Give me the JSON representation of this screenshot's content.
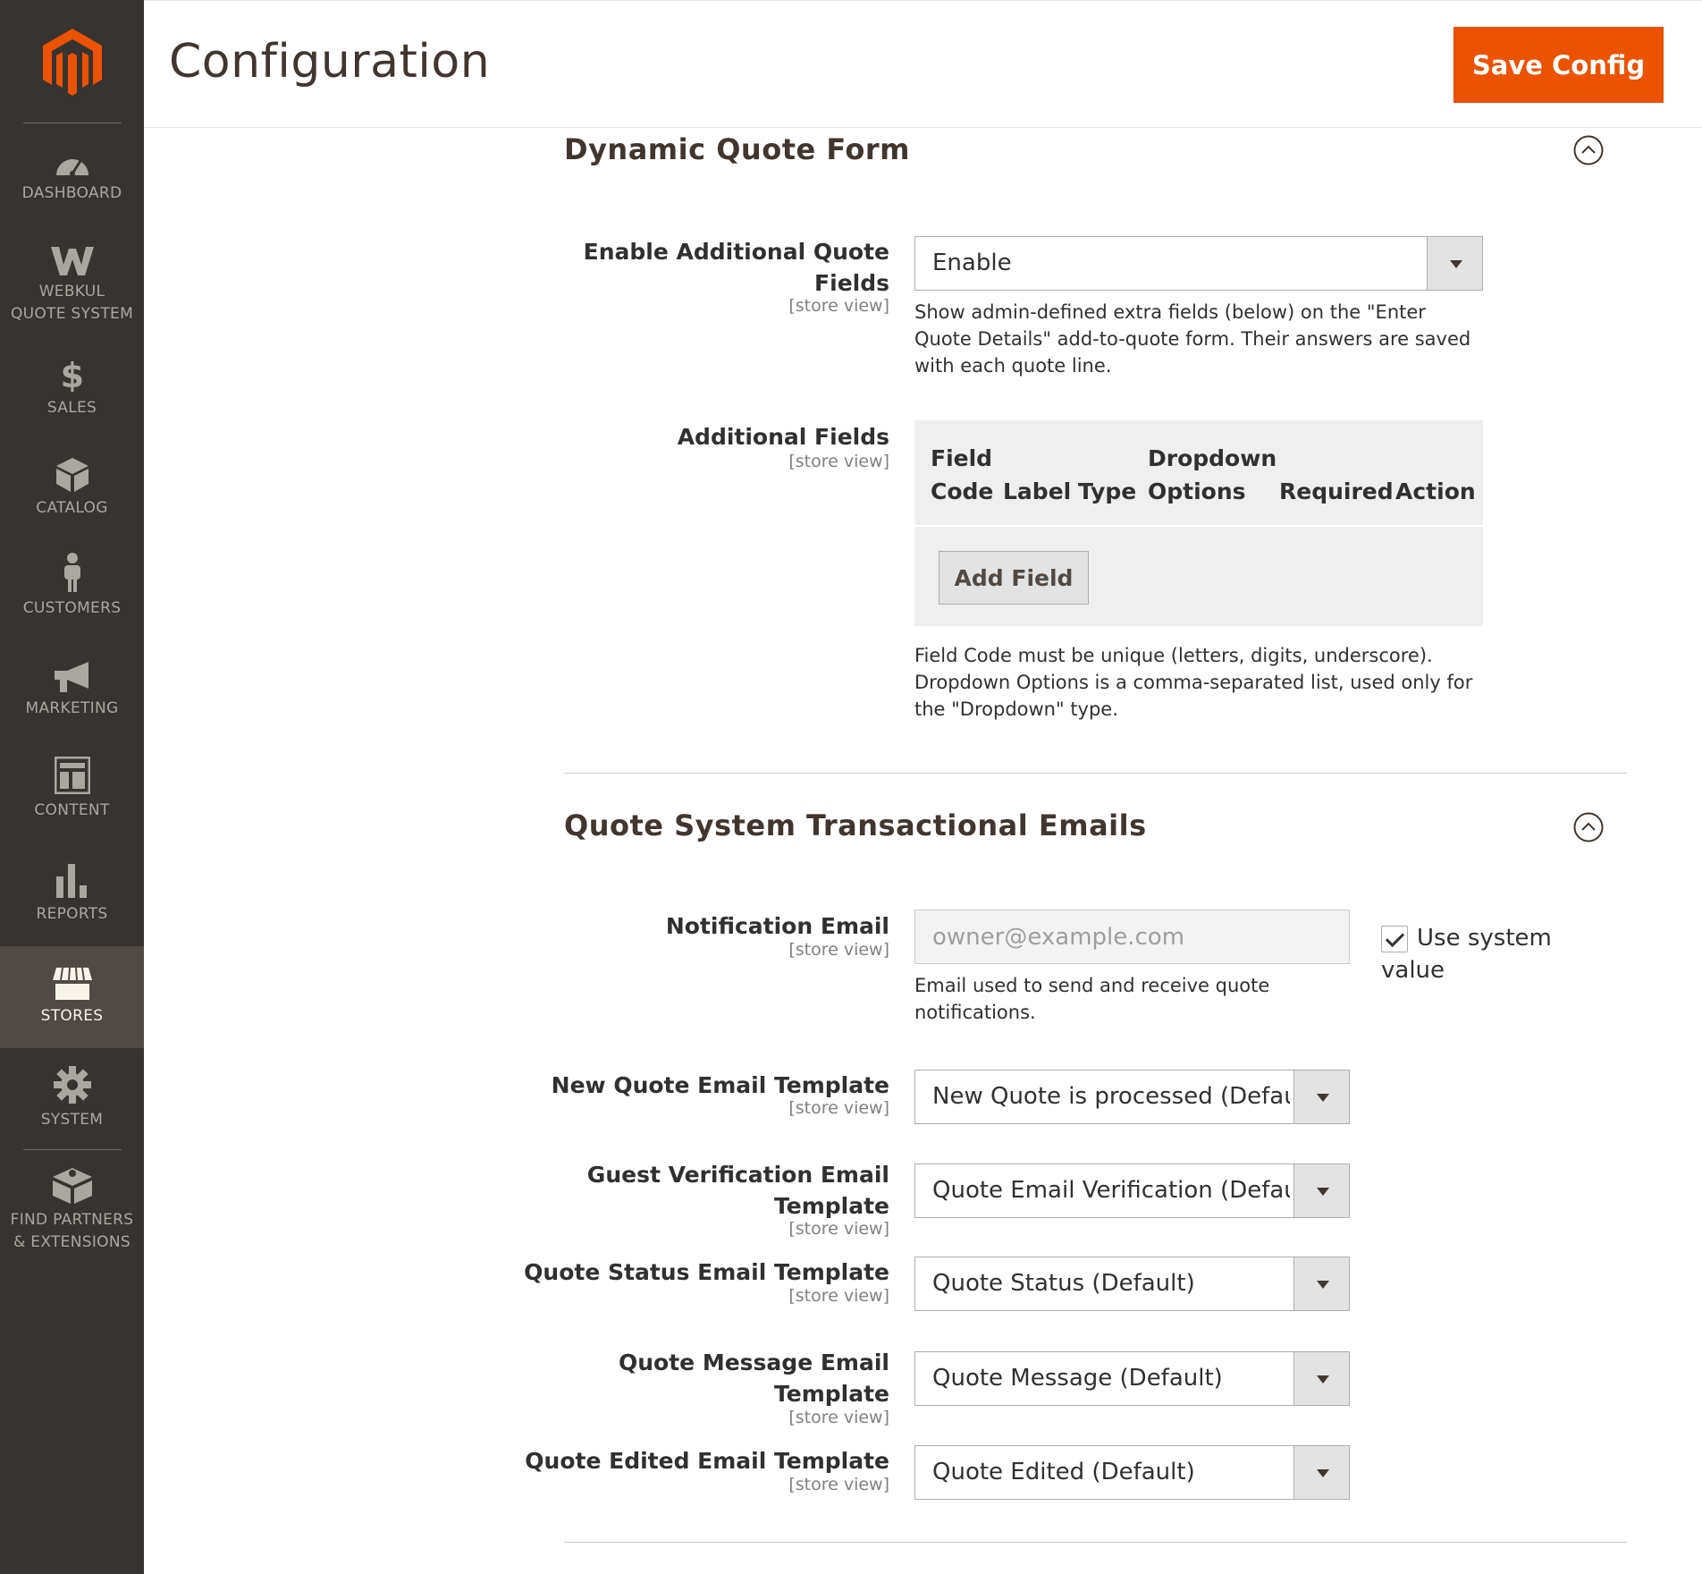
{
  "header": {
    "title": "Configuration",
    "save_label": "Save Config"
  },
  "sidebar": {
    "items": [
      {
        "label": "DASHBOARD",
        "icon": "dashboard-icon"
      },
      {
        "label": "WEBKUL QUOTE SYSTEM",
        "icon": "webkul-icon"
      },
      {
        "label": "SALES",
        "icon": "dollar-icon"
      },
      {
        "label": "CATALOG",
        "icon": "box-icon"
      },
      {
        "label": "CUSTOMERS",
        "icon": "person-icon"
      },
      {
        "label": "MARKETING",
        "icon": "megaphone-icon"
      },
      {
        "label": "CONTENT",
        "icon": "layout-icon"
      },
      {
        "label": "REPORTS",
        "icon": "bar-chart-icon"
      },
      {
        "label": "STORES",
        "icon": "store-icon",
        "active": true
      },
      {
        "label": "SYSTEM",
        "icon": "gear-icon"
      },
      {
        "label": "FIND PARTNERS & EXTENSIONS",
        "icon": "blocks-icon"
      }
    ]
  },
  "dynamic_form": {
    "title": "Dynamic Quote Form",
    "enable_label": "Enable Additional Quote Fields",
    "enable_scope": "[store view]",
    "enable_value": "Enable",
    "enable_note": "Show admin-defined extra fields (below) on the \"Enter Quote Details\" add-to-quote form. Their answers are saved with each quote line.",
    "fields_label": "Additional Fields",
    "fields_scope": "[store view]",
    "columns": [
      "Field Code",
      "Label",
      "Type",
      "Dropdown Options",
      "Required",
      "Action"
    ],
    "add_field_label": "Add Field",
    "fields_note": "Field Code must be unique (letters, digits, underscore). Dropdown Options is a comma-separated list, used only for the \"Dropdown\" type."
  },
  "emails": {
    "title": "Quote System Transactional Emails",
    "notification_label": "Notification Email",
    "notification_scope": "[store view]",
    "notification_placeholder": "owner@example.com",
    "use_system_value": "Use system value",
    "notification_note": "Email used to send and receive quote notifications.",
    "new_quote_label": "New Quote Email Template",
    "new_quote_scope": "[store view]",
    "new_quote_value": "New Quote is processed (Default)",
    "guest_label": "Guest Verification Email Template",
    "guest_scope": "[store view]",
    "guest_value": "Quote Email Verification (Default)",
    "status_label": "Quote Status Email Template",
    "status_scope": "[store view]",
    "status_value": "Quote Status (Default)",
    "message_label": "Quote Message Email Template",
    "message_scope": "[store view]",
    "message_value": "Quote Message (Default)",
    "edited_label": "Quote Edited Email Template",
    "edited_scope": "[store view]",
    "edited_value": "Quote Edited (Default)"
  },
  "colors": {
    "sidebar": "#373330",
    "accent": "#eb5202",
    "active_nav": "#514943"
  }
}
